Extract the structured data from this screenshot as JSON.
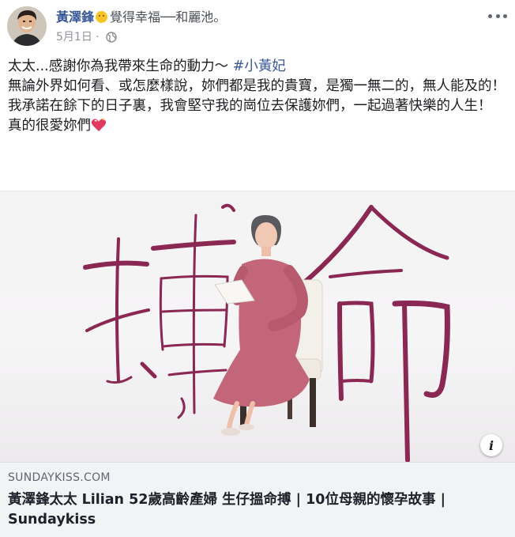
{
  "header": {
    "author_name": "黃澤鋒",
    "feeling_text": "覺得幸福──和麗池。",
    "date": "5月1日",
    "emoji": "smile-emoji",
    "privacy_icon": "globe-icon",
    "more_icon": "more-options-icon"
  },
  "post": {
    "line1_text": "太太...感謝你為我帶來生命的動力～ ",
    "line1_hashtag": "#小黃妃",
    "line2": "無論外界如何看、或怎麼樣說，妳們都是我的貴寶，是獨一無二的，無人能及的！",
    "line3": "我承諾在餘下的日子裏，我會堅守我的崗位去保護妳們，一起過著快樂的人生！",
    "line4_text": "真的很愛妳們",
    "line4_emoji": "sparkling-heart-icon"
  },
  "link_preview": {
    "image_title_art": "搵命",
    "info_icon_glyph": "i",
    "domain": "SUNDAYKISS.COM",
    "title": "黃澤鋒太太 Lilian 52歲高齡產婦 生仔搵命搏 | 10位母親的懷孕故事 | Sundaykiss"
  },
  "colors": {
    "link_blue": "#385898",
    "text": "#1c1e21",
    "muted": "#90949c",
    "calligraphy": "#8a2752",
    "dress": "#c4667a",
    "caption_bg": "#f2f3f5"
  }
}
